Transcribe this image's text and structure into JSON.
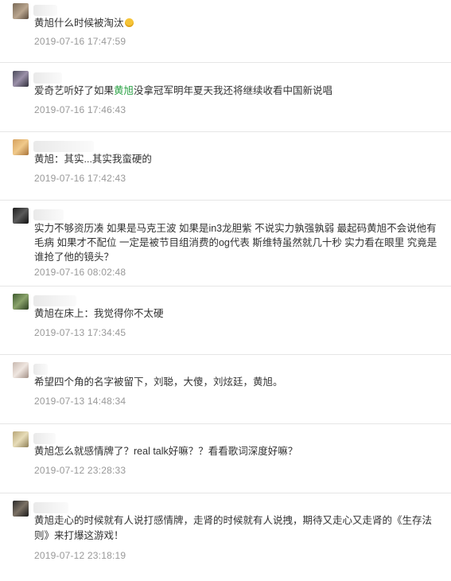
{
  "comments": [
    {
      "text": "黄旭什么时候被淘汰",
      "time": "2019-07-16 17:47:59",
      "emoji": "slightly-smiling-face-emoji"
    },
    {
      "text_before": "爱奇艺听好了如果",
      "highlight": "黄旭",
      "text_after": "没拿冠军明年夏天我还将继续收看中国新说唱",
      "time": "2019-07-16 17:46:43"
    },
    {
      "text": "黄旭：其实...其实我蛮硬的",
      "time": "2019-07-16 17:42:43"
    },
    {
      "text": "实力不够资历凑 如果是马克王波 如果是in3龙胆紫 不说实力孰强孰弱 最起码黄旭不会说他有毛病 如果才不配位 一定是被节目组消费的og代表 斯维特虽然就几十秒 实力看在眼里 究竟是谁抢了他的镜头？",
      "time": "2019-07-16 08:02:48"
    },
    {
      "text": "黄旭在床上：我觉得你不太硬",
      "time": "2019-07-13 17:34:45"
    },
    {
      "text": "希望四个角的名字被留下，刘聪，大傻，刘炫廷，黄旭。",
      "time": "2019-07-13 14:48:34"
    },
    {
      "text": "黄旭怎么就感情牌了？real talk好嘛？？看看歌词深度好嘛？",
      "time": "2019-07-12 23:28:33"
    },
    {
      "text": "黄旭走心的时候就有人说打感情牌，走肾的时候就有人说拽，期待又走心又走肾的《生存法则》来打爆这游戏！",
      "time": "2019-07-12 23:18:19"
    }
  ]
}
